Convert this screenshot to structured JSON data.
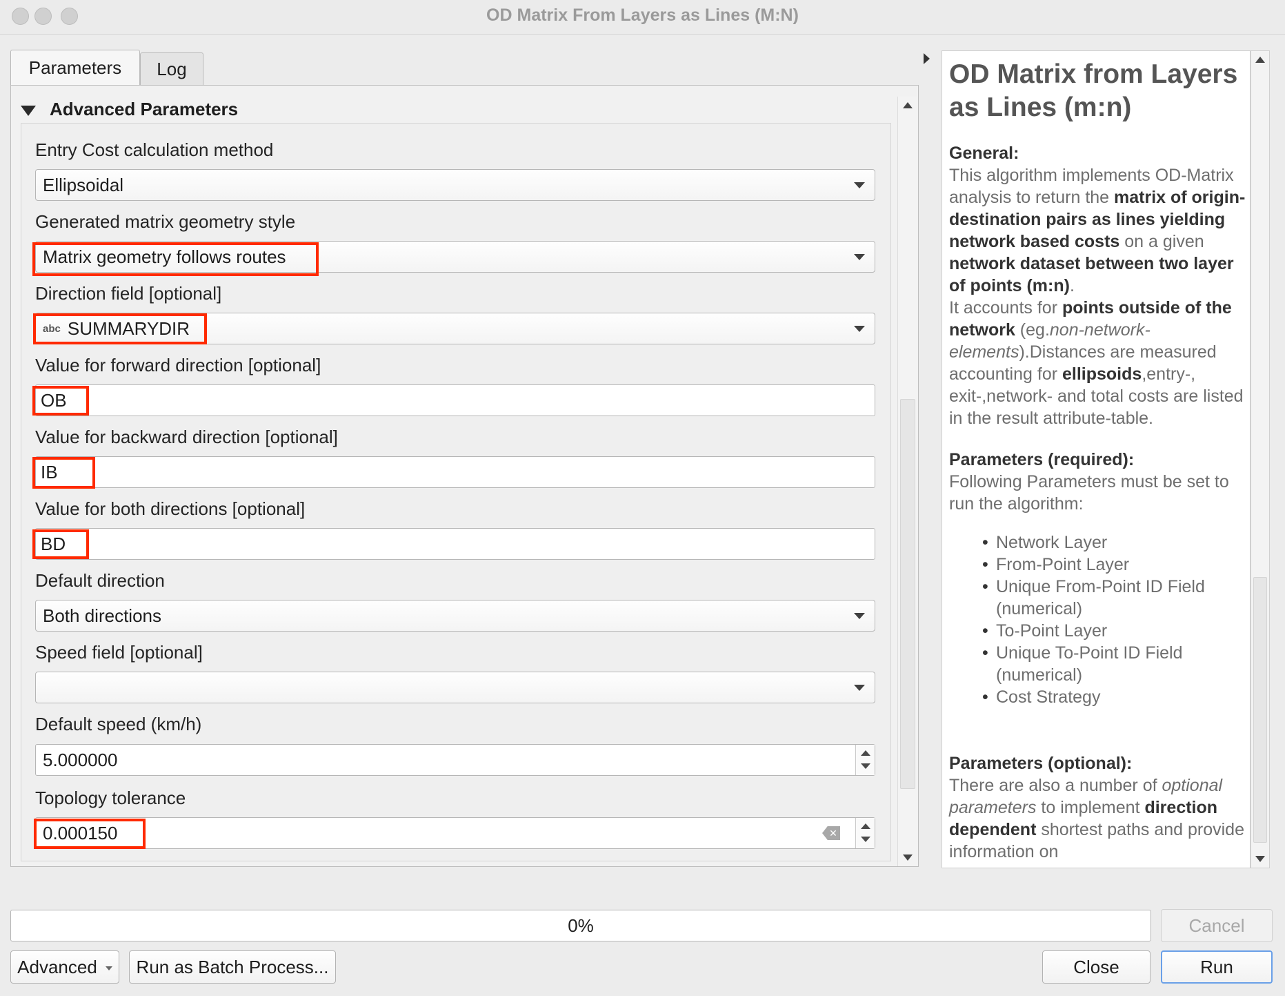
{
  "window": {
    "title": "OD Matrix From Layers as Lines (M:N)"
  },
  "tabs": [
    {
      "label": "Parameters",
      "active": true
    },
    {
      "label": "Log",
      "active": false
    }
  ],
  "advanced": {
    "header": "Advanced Parameters",
    "entry_cost": {
      "label": "Entry Cost calculation method",
      "value": "Ellipsoidal"
    },
    "geometry_style": {
      "label": "Generated matrix geometry style",
      "value": "Matrix geometry follows routes"
    },
    "direction_field": {
      "label": "Direction field [optional]",
      "type_badge": "abc",
      "value": "SUMMARYDIR"
    },
    "forward": {
      "label": "Value for forward direction [optional]",
      "value": "OB"
    },
    "backward": {
      "label": "Value for backward direction [optional]",
      "value": "IB"
    },
    "both": {
      "label": "Value for both directions [optional]",
      "value": "BD"
    },
    "default_direction": {
      "label": "Default direction",
      "value": "Both directions"
    },
    "speed_field": {
      "label": "Speed field [optional]",
      "value": ""
    },
    "default_speed": {
      "label": "Default speed (km/h)",
      "value": "5.000000"
    },
    "tolerance": {
      "label": "Topology tolerance",
      "value": "0.000150"
    }
  },
  "help": {
    "title": "OD Matrix from Layers as Lines (m:n)",
    "general_heading": "General:",
    "general_1": "This algorithm implements OD-Matrix analysis to return the ",
    "general_b1": "matrix of origin-destination pairs as lines yielding network based costs",
    "general_2": " on a given ",
    "general_b2": "network dataset between two layer of points (m:n)",
    "general_3": ".",
    "accounts_1": "It accounts for ",
    "accounts_b1": "points outside of the network",
    "accounts_2": " (eg.",
    "accounts_i1": "non-network-elements",
    "accounts_3": ").Distances are measured accounting for ",
    "accounts_b2": "ellipsoids",
    "accounts_4": ",entry-, exit-,network- and total costs are listed in the result attribute-table.",
    "required_heading": "Parameters (required):",
    "required_text": "Following Parameters must be set to run the algorithm:",
    "required_items": [
      "Network Layer",
      "From-Point Layer",
      "Unique From-Point ID Field (numerical)",
      "To-Point Layer",
      "Unique To-Point ID Field (numerical)",
      "Cost Strategy"
    ],
    "optional_heading": "Parameters (optional):",
    "optional_1": "There are also a number of ",
    "optional_i1": "optional parameters",
    "optional_2": " to implement ",
    "optional_b1": "direction dependent",
    "optional_3": " shortest paths and provide information on"
  },
  "bottom": {
    "progress": "0%",
    "progress_value": 0,
    "cancel": "Cancel",
    "advanced": "Advanced",
    "batch": "Run as Batch Process...",
    "close": "Close",
    "run": "Run"
  },
  "colors": {
    "highlight": "#ff2a00",
    "default_button": "#6aa0e8"
  },
  "icons": {
    "clear": "backspace-clear-icon",
    "collapse": "triangle-down-icon"
  }
}
